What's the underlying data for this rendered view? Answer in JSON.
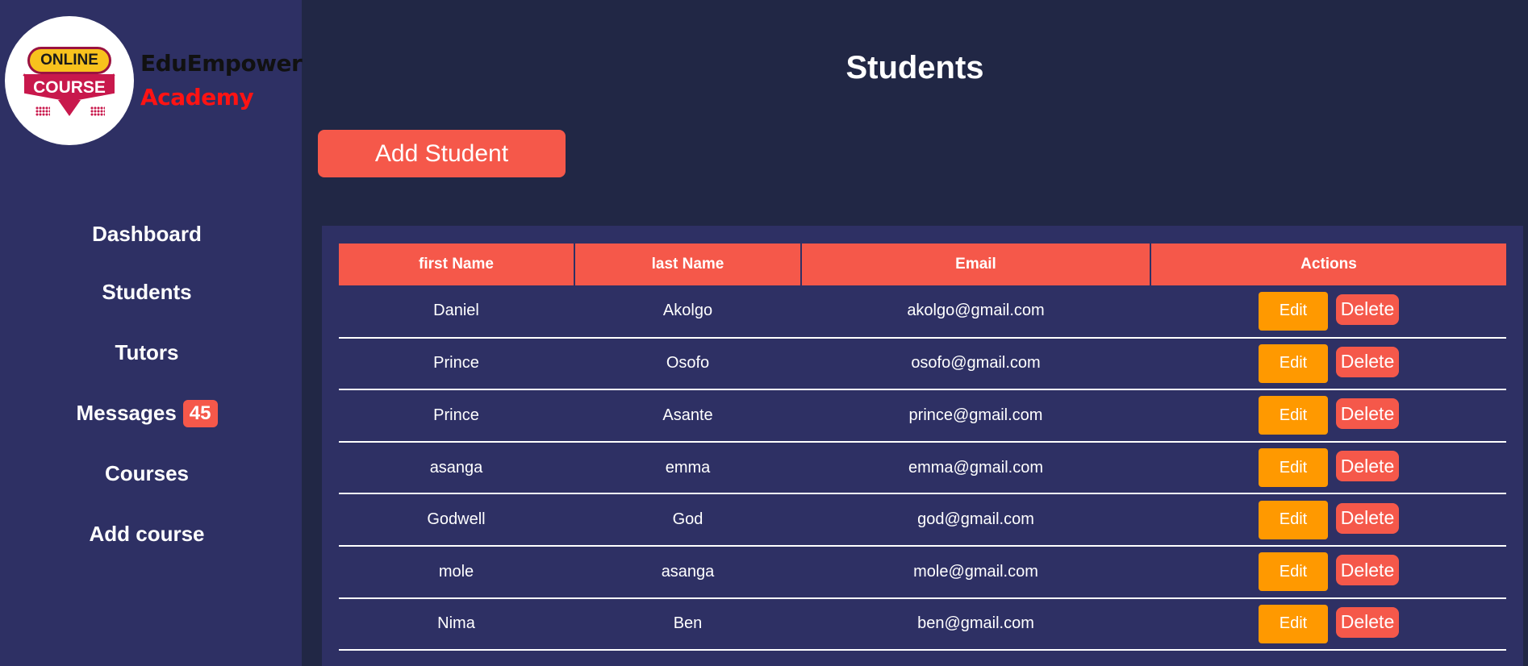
{
  "brand": {
    "logo_top": "ONLINE",
    "logo_bottom": "COURSE",
    "name": "EduEmpower",
    "subtitle": "Academy"
  },
  "sidebar": {
    "items": [
      {
        "label": "Dashboard"
      },
      {
        "label": "Students"
      },
      {
        "label": "Tutors"
      },
      {
        "label": "Messages",
        "badge": "45"
      },
      {
        "label": "Courses"
      },
      {
        "label": "Add course"
      }
    ]
  },
  "main": {
    "title": "Students",
    "add_button": "Add Student"
  },
  "table": {
    "headers": [
      "first Name",
      "last Name",
      "Email",
      "Actions"
    ],
    "edit_label": "Edit",
    "delete_label": "Delete",
    "rows": [
      {
        "first": "Daniel",
        "last": "Akolgo",
        "email": "akolgo@gmail.com"
      },
      {
        "first": "Prince",
        "last": "Osofo",
        "email": "osofo@gmail.com"
      },
      {
        "first": "Prince",
        "last": "Asante",
        "email": "prince@gmail.com"
      },
      {
        "first": "asanga",
        "last": "emma",
        "email": "emma@gmail.com"
      },
      {
        "first": "Godwell",
        "last": "God",
        "email": "god@gmail.com"
      },
      {
        "first": "mole",
        "last": "asanga",
        "email": "mole@gmail.com"
      },
      {
        "first": "Nima",
        "last": "Ben",
        "email": "ben@gmail.com"
      }
    ]
  },
  "colors": {
    "background": "#212745",
    "sidebar": "#2e3064",
    "accent": "#f5584a",
    "edit": "#ff9900",
    "brand_sub": "#ff1313"
  }
}
